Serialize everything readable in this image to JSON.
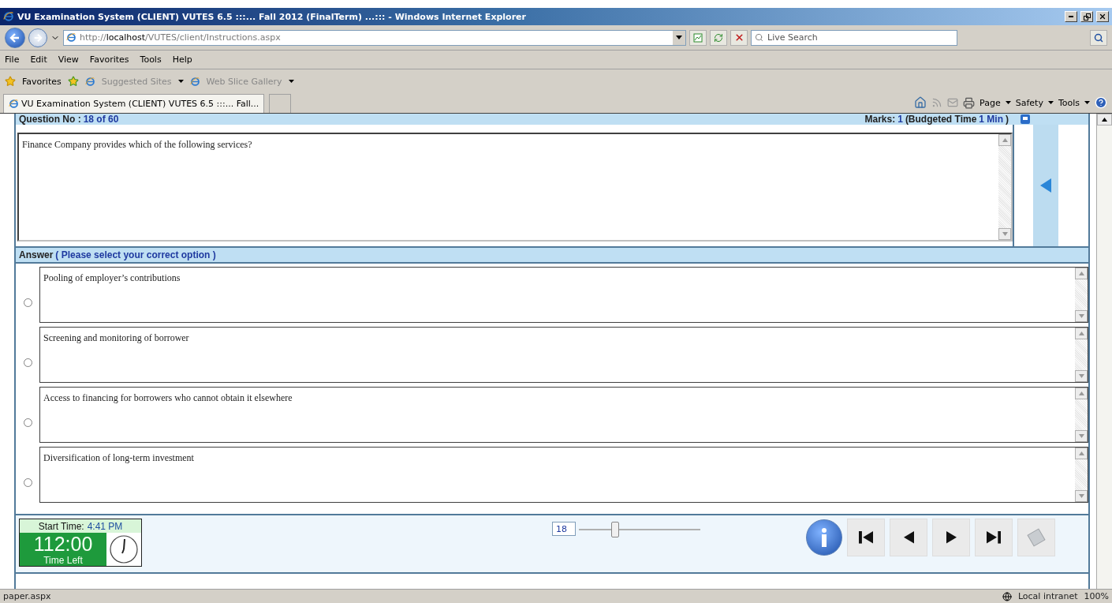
{
  "window": {
    "title": "VU Examination System (CLIENT) VUTES 6.5 :::... Fall 2012 (FinalTerm) ...::: - Windows Internet Explorer"
  },
  "address_bar": {
    "prefix": "http://",
    "host": "localhost",
    "path": "/VUTES/client/Instructions.aspx"
  },
  "search": {
    "placeholder": "Live Search"
  },
  "menu": [
    "File",
    "Edit",
    "View",
    "Favorites",
    "Tools",
    "Help"
  ],
  "favorites_bar": {
    "label": "Favorites",
    "links": [
      "Suggested Sites",
      "Web Slice Gallery"
    ]
  },
  "tabs": [
    {
      "label": "VU Examination System (CLIENT) VUTES 6.5 :::... Fall...",
      "selected": true
    }
  ],
  "command_bar": [
    "Page",
    "Safety",
    "Tools"
  ],
  "question": {
    "label": "Question No :",
    "number": "18 of 60",
    "marks_label": "Marks:",
    "marks": "1",
    "budget_label": "(Budgeted Time",
    "budget": "1 Min",
    "budget_end": ")",
    "text": "Finance Company provides which of the following services?"
  },
  "answer": {
    "label": "Answer",
    "hint": "( Please select your correct option )",
    "options": [
      {
        "text": "Pooling of employer’s contributions",
        "selected": false
      },
      {
        "text": "Screening and monitoring of borrower",
        "selected": false
      },
      {
        "text": "Access to financing for borrowers who cannot obtain it elsewhere",
        "selected": false
      },
      {
        "text": "Diversification of long-term investment",
        "selected": false
      }
    ]
  },
  "footer": {
    "start_label": "Start Time:",
    "start_time": "4:41 PM",
    "time_left": "112:00",
    "time_left_label": "Time Left",
    "question_index": "18",
    "slider": {
      "level": 0.3
    }
  },
  "status_bar": {
    "url": "paper.aspx",
    "zone": "Local intranet",
    "zoom": "100%"
  }
}
